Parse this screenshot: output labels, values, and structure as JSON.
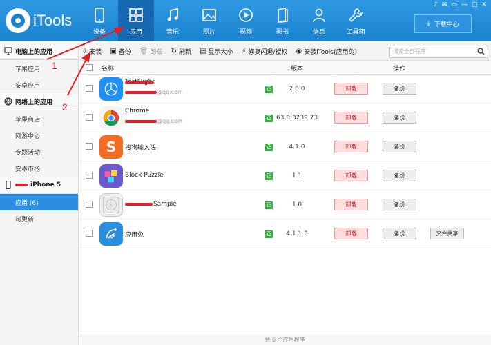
{
  "app": {
    "logo_text": "iTools"
  },
  "nav": [
    {
      "label": "设备",
      "icon": "phone-icon"
    },
    {
      "label": "应用",
      "icon": "apps-grid-icon"
    },
    {
      "label": "音乐",
      "icon": "music-note-icon"
    },
    {
      "label": "照片",
      "icon": "photo-icon"
    },
    {
      "label": "视频",
      "icon": "play-icon"
    },
    {
      "label": "图书",
      "icon": "book-icon"
    },
    {
      "label": "信息",
      "icon": "person-icon"
    },
    {
      "label": "工具箱",
      "icon": "wrench-icon"
    }
  ],
  "window_controls": [
    "♪",
    "✉",
    "▭",
    "—",
    "▢",
    "✕"
  ],
  "download_center": "下载中心",
  "sidebar": {
    "pc_apps": {
      "title": "电脑上的应用",
      "items": [
        "苹果应用",
        "安卓应用"
      ]
    },
    "net_apps": {
      "title": "网络上的应用",
      "items": [
        "苹果商店",
        "网游中心",
        "专题活动",
        "安卓市场"
      ]
    },
    "device": {
      "title": "iPhone 5",
      "items": [
        "应用 (6)",
        "可更新"
      ]
    }
  },
  "toolbar": {
    "install": "安装",
    "backup": "备份",
    "uninstall": "卸载",
    "refresh": "刷新",
    "show_size": "显示大小",
    "fix_crash": "修复闪退/授权",
    "install_itools": "安装iTools(应用兔)",
    "search_placeholder": "搜索全部程序"
  },
  "table": {
    "col_name": "名称",
    "col_version": "版本",
    "col_action": "操作"
  },
  "rows": [
    {
      "name": "TestFlight",
      "sub": "@qq.com",
      "badge": "正",
      "version": "2.0.0",
      "uninstall": "卸载",
      "backup": "备份",
      "icon": "testflight-icon",
      "color": "#1e90ff"
    },
    {
      "name": "Chrome",
      "sub": "@qq.com",
      "badge": "正",
      "version": "63.0.3239.73",
      "uninstall": "卸载",
      "backup": "备份",
      "icon": "chrome-icon",
      "color": "#4caf50"
    },
    {
      "name": "搜狗输入法",
      "sub": "",
      "badge": "正",
      "version": "4.1.0",
      "uninstall": "卸载",
      "backup": "备份",
      "icon": "sogou-icon",
      "color": "#f36c21"
    },
    {
      "name": "Block Puzzle",
      "sub": "",
      "badge": "正",
      "version": "1.1",
      "uninstall": "卸载",
      "backup": "备份",
      "icon": "block-puzzle-icon",
      "color": "#6a5acd"
    },
    {
      "name": "Sample",
      "sub": "",
      "badge": "正",
      "version": "1.0",
      "uninstall": "卸载",
      "backup": "备份",
      "icon": "sample-app-icon",
      "color": "#dddddd"
    },
    {
      "name": "应用兔",
      "sub": "",
      "badge": "正",
      "version": "4.1.1.3",
      "uninstall": "卸载",
      "backup": "备份",
      "fileshare": "文件共享",
      "icon": "yingyongtu-icon",
      "color": "#2a8de0"
    }
  ],
  "footer": "共 6 个应用程序",
  "annotations": {
    "one": "1",
    "two": "2"
  }
}
